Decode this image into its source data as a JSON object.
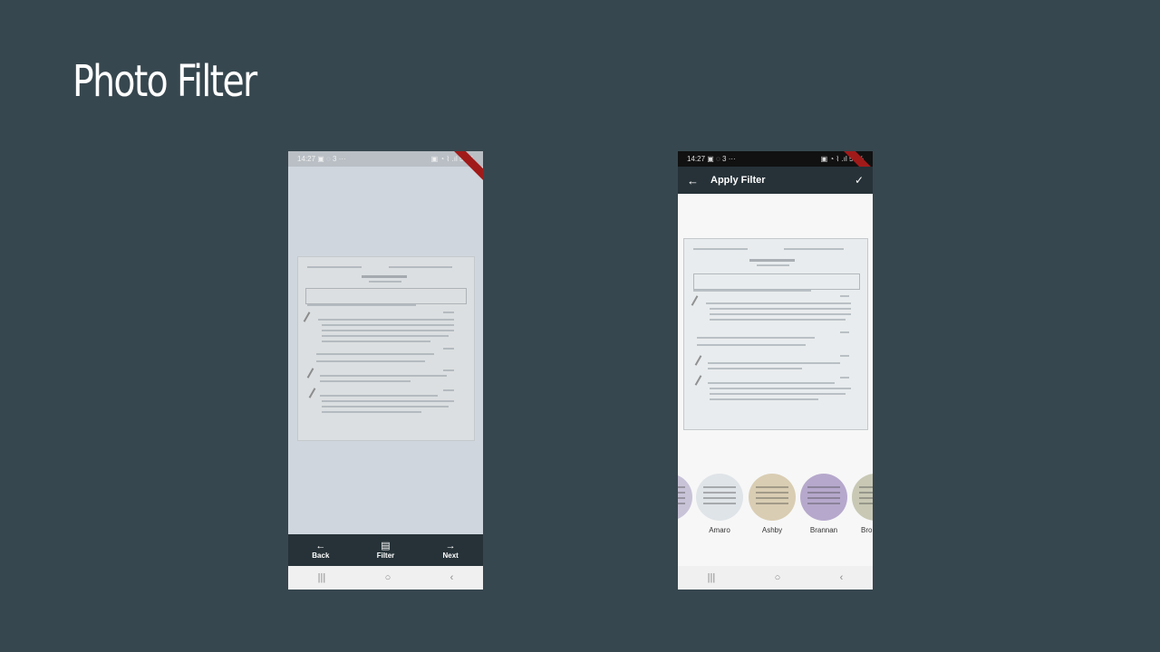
{
  "slide": {
    "title": "Photo Filter"
  },
  "left_phone": {
    "status": {
      "time": "14:27",
      "left_icons": "▣ ◌ 3  ···",
      "right_icons": "▣ ◔ ⌇ .ıl 57%"
    },
    "bottom_bar": [
      {
        "icon": "←",
        "label": "Back"
      },
      {
        "icon": "▤",
        "label": "Filter"
      },
      {
        "icon": "→",
        "label": "Next"
      }
    ],
    "nav": {
      "recents": "|||",
      "home": "○",
      "back": "‹"
    }
  },
  "right_phone": {
    "status": {
      "time": "14:27",
      "left_icons": "▣ ◌ 3  ···",
      "right_icons": "▣ ◔ ⌇ .ıl 57%"
    },
    "app_bar": {
      "back_icon": "←",
      "title": "Apply Filter",
      "confirm_icon": "✓"
    },
    "filters": [
      {
        "label": "",
        "tint": "#c9c3d8"
      },
      {
        "label": "Amaro",
        "tint": "#dfe4e8"
      },
      {
        "label": "Ashby",
        "tint": "#d9cdb3"
      },
      {
        "label": "Brannan",
        "tint": "#b6a8cc"
      },
      {
        "label": "Bro",
        "tint": "#c8c8b5"
      }
    ],
    "nav": {
      "recents": "|||",
      "home": "○",
      "back": "‹"
    }
  }
}
